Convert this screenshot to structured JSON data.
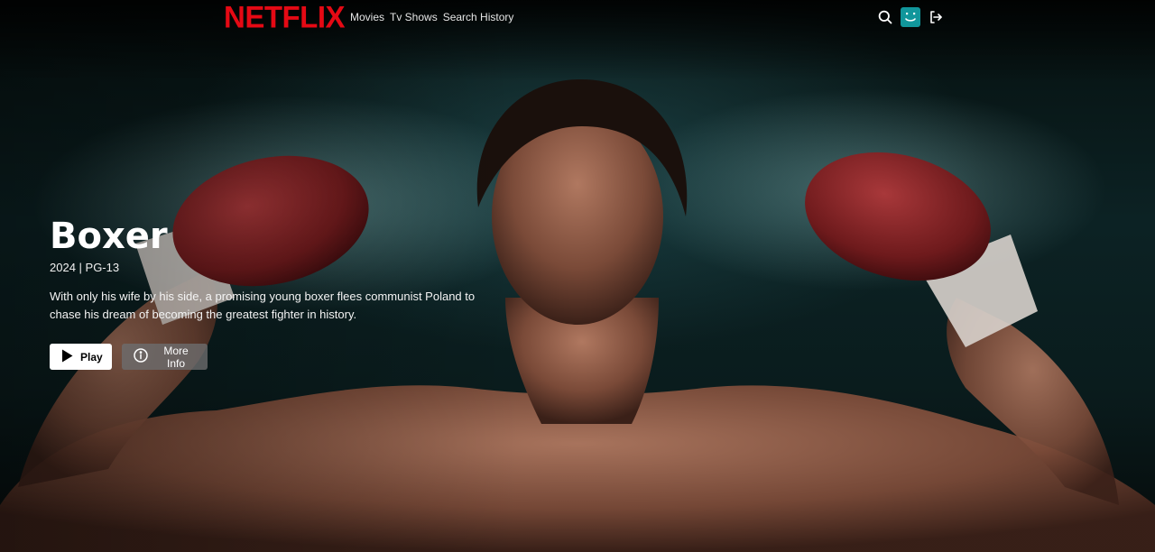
{
  "brand": {
    "logo_text": "NETFLIX",
    "accent_color": "#e50914",
    "avatar_color": "#11969b"
  },
  "nav": {
    "links": [
      "Movies",
      "Tv Shows",
      "Search History"
    ],
    "icons": [
      "search-icon",
      "avatar-icon",
      "logout-icon"
    ]
  },
  "hero": {
    "title": "Boxer",
    "meta": "2024 | PG-13",
    "description": "With only his wife by his side, a promising young boxer flees communist Poland to chase his dream of becoming the greatest fighter in history.",
    "play_label": "Play",
    "more_info_label": "More Info"
  }
}
